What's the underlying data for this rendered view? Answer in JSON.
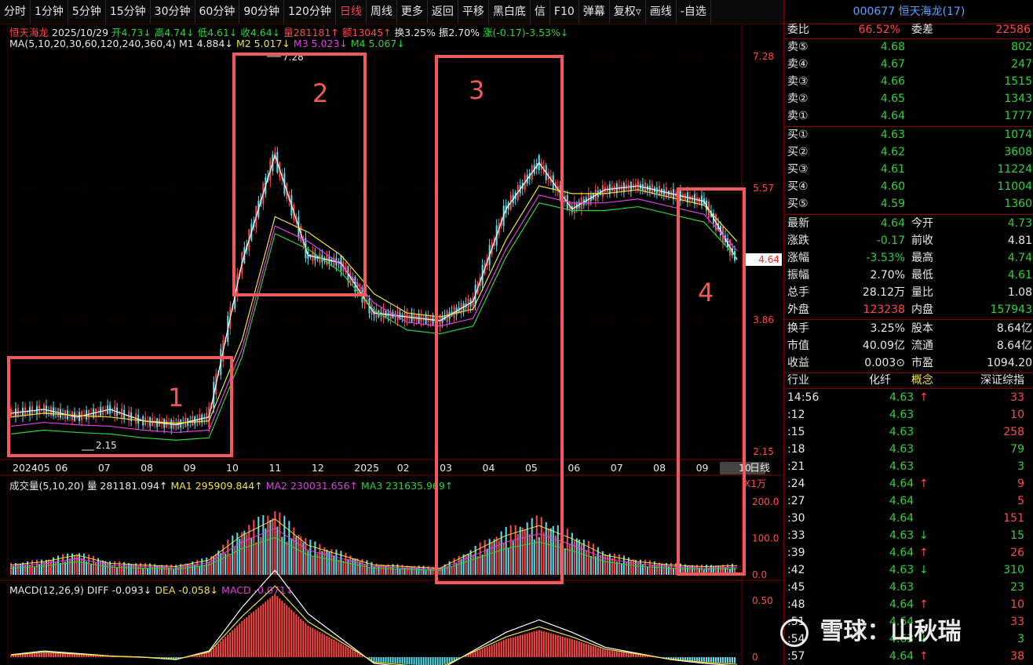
{
  "toolbar": [
    "分时",
    "1分钟",
    "5分钟",
    "15分钟",
    "30分钟",
    "60分钟",
    "90分钟",
    "120分钟",
    "日线",
    "周线",
    "更多",
    "返回",
    "平移",
    "黑白底",
    "信",
    "F10",
    "弹幕",
    "复权▿",
    "画线",
    "-自选"
  ],
  "toolbar_active": "日线",
  "kline_info": {
    "name": "恒天海龙",
    "date": "2025/10/29",
    "open": "开4.73↓",
    "high": "高4.74↓",
    "low": "低4.61↓",
    "close": "收4.64↓",
    "vol": "量281181↑",
    "amount": "额13045↑",
    "turnover": "换3.25%",
    "amplitude": "振2.70%",
    "change": "涨(-0.17)-3.53%↓"
  },
  "ma_info": {
    "label": "MA(5,10,20,30,60,120,240,360,4)",
    "m1": "M1 4.884↓",
    "m2": "M2 5.017↓",
    "m3": "M3 5.023↓",
    "m4": "M4 5.067↓"
  },
  "price_axis": [
    "7.28",
    "5.57",
    "3.86",
    "2.15"
  ],
  "price_marks": {
    "high_label": "7.28",
    "low_label": "2.15",
    "current": "4.64"
  },
  "date_axis": [
    "202405",
    "06",
    "07",
    "08",
    "09",
    "10",
    "11",
    "12",
    "2025",
    "02",
    "03",
    "04",
    "05",
    "06",
    "07",
    "08",
    "09",
    "10"
  ],
  "date_axis_right": "日线",
  "volume_info": {
    "label": "成交量(5,10,20)",
    "vol": "量 281181.094↑",
    "ma1": "MA1 295909.844↑",
    "ma2": "MA2 230031.656↑",
    "ma3": "MA3 231635.969↑",
    "unit": "X1万"
  },
  "volume_axis": [
    "200.0",
    "100.0",
    "0.0"
  ],
  "macd_info": {
    "label": "MACD(12,26,9)",
    "diff": "DIFF -0.093↓",
    "dea": "DEA -0.058↓",
    "macd": "MACD -0.071↓"
  },
  "macd_axis": [
    "0.50",
    "0"
  ],
  "annotations": [
    "1",
    "2",
    "3",
    "4"
  ],
  "panel": {
    "title": "000677 恒天海龙(17)",
    "weibi": {
      "label": "委比",
      "value": "66.52%",
      "label2": "委差",
      "value2": "22586"
    },
    "sell": [
      {
        "label": "卖⑤",
        "price": "4.68",
        "vol": "802"
      },
      {
        "label": "卖④",
        "price": "4.67",
        "vol": "247"
      },
      {
        "label": "卖③",
        "price": "4.66",
        "vol": "1515"
      },
      {
        "label": "卖②",
        "price": "4.65",
        "vol": "1343"
      },
      {
        "label": "卖①",
        "price": "4.64",
        "vol": "1777"
      }
    ],
    "buy": [
      {
        "label": "买①",
        "price": "4.63",
        "vol": "1074"
      },
      {
        "label": "买②",
        "price": "4.62",
        "vol": "3608"
      },
      {
        "label": "买③",
        "price": "4.61",
        "vol": "11224"
      },
      {
        "label": "买④",
        "price": "4.60",
        "vol": "11004"
      },
      {
        "label": "买⑤",
        "price": "4.59",
        "vol": "1360"
      }
    ],
    "stats": [
      {
        "l1": "最新",
        "v1": "4.64",
        "c1": "green",
        "l2": "今开",
        "v2": "4.73",
        "c2": "green"
      },
      {
        "l1": "涨跌",
        "v1": "-0.17",
        "c1": "green",
        "l2": "前收",
        "v2": "4.81",
        "c2": "white"
      },
      {
        "l1": "涨幅",
        "v1": "-3.53%",
        "c1": "green",
        "l2": "最高",
        "v2": "4.74",
        "c2": "green"
      },
      {
        "l1": "振幅",
        "v1": "2.70%",
        "c1": "white",
        "l2": "最低",
        "v2": "4.61",
        "c2": "green"
      },
      {
        "l1": "总手",
        "v1": "28.12万",
        "c1": "white",
        "l2": "量比",
        "v2": "1.08",
        "c2": "white"
      },
      {
        "l1": "外盘",
        "v1": "123238",
        "c1": "red",
        "l2": "内盘",
        "v2": "157943",
        "c2": "green"
      }
    ],
    "stats2": [
      {
        "l1": "换手",
        "v1": "3.25%",
        "l2": "股本",
        "v2": "8.64亿"
      },
      {
        "l1": "市值",
        "v1": "40.09亿",
        "l2": "流通",
        "v2": "8.64亿"
      },
      {
        "l1": "收益",
        "v1": "0.003⊙",
        "l2": "市盈",
        "v2": "1094.20"
      }
    ],
    "industry": {
      "label": "行业",
      "value": "化纤",
      "label2": "概念",
      "value2": "深证综指"
    },
    "ticks": [
      {
        "t": "14:56",
        "p": "4.63",
        "a": "↑",
        "v": "33",
        "vc": "red"
      },
      {
        "t": ":12",
        "p": "4.63",
        "a": "",
        "v": "10",
        "vc": "red"
      },
      {
        "t": ":15",
        "p": "4.63",
        "a": "",
        "v": "258",
        "vc": "red"
      },
      {
        "t": ":18",
        "p": "4.63",
        "a": "",
        "v": "79",
        "vc": "green"
      },
      {
        "t": ":21",
        "p": "4.63",
        "a": "",
        "v": "3",
        "vc": "green"
      },
      {
        "t": ":24",
        "p": "4.64",
        "a": "↑",
        "v": "9",
        "vc": "red"
      },
      {
        "t": ":27",
        "p": "4.64",
        "a": "",
        "v": "5",
        "vc": "red"
      },
      {
        "t": ":30",
        "p": "4.64",
        "a": "",
        "v": "151",
        "vc": "red"
      },
      {
        "t": ":33",
        "p": "4.63",
        "a": "↓",
        "v": "15",
        "vc": "green"
      },
      {
        "t": ":39",
        "p": "4.64",
        "a": "↑",
        "v": "26",
        "vc": "red"
      },
      {
        "t": ":42",
        "p": "4.63",
        "a": "↓",
        "v": "310",
        "vc": "green"
      },
      {
        "t": ":45",
        "p": "4.63",
        "a": "",
        "v": "23",
        "vc": "green"
      },
      {
        "t": ":48",
        "p": "4.64",
        "a": "↑",
        "v": "10",
        "vc": "red"
      },
      {
        "t": ":51",
        "p": "4.64",
        "a": "",
        "v": "33",
        "vc": "red"
      },
      {
        "t": ":54",
        "p": "4.63",
        "a": "↓",
        "v": "3",
        "vc": "green"
      },
      {
        "t": ":57",
        "p": "4.64",
        "a": "↑",
        "v": "38",
        "vc": "red"
      }
    ]
  },
  "watermark": "雪球：山秋瑞",
  "chart_data": {
    "type": "line",
    "title": "",
    "ylim": [
      2.15,
      7.28
    ],
    "x": [
      "202405",
      "06",
      "07",
      "08",
      "09",
      "10",
      "11",
      "12",
      "2025",
      "02",
      "03",
      "04",
      "05",
      "06",
      "07",
      "08",
      "09",
      "10"
    ],
    "series": [
      {
        "values": [
          2.65,
          2.7,
          2.6,
          2.7,
          2.55,
          2.5,
          2.6,
          4.6,
          6.0,
          4.7,
          4.6,
          3.95,
          3.9,
          3.85,
          4.1,
          5.3,
          5.9,
          5.3,
          5.55,
          5.6,
          5.5,
          5.4,
          4.64
        ]
      },
      {
        "name": "M1",
        "values": [
          2.6,
          2.65,
          2.62,
          2.6,
          2.55,
          2.52,
          2.55,
          3.6,
          5.2,
          5.0,
          4.7,
          4.2,
          3.95,
          3.9,
          4.0,
          4.9,
          5.6,
          5.5,
          5.5,
          5.55,
          5.45,
          5.35,
          4.88
        ]
      }
    ],
    "volume": [
      30,
      40,
      60,
      35,
      30,
      25,
      45,
      120,
      170,
      90,
      60,
      30,
      25,
      20,
      70,
      120,
      150,
      110,
      60,
      40,
      30,
      25,
      28
    ],
    "macd": [
      0.02,
      0.05,
      0.03,
      0.01,
      0.0,
      -0.02,
      0.05,
      0.4,
      0.7,
      0.35,
      0.15,
      -0.05,
      -0.08,
      -0.1,
      0.05,
      0.2,
      0.3,
      0.2,
      0.08,
      0.03,
      -0.02,
      -0.05,
      -0.07
    ]
  }
}
